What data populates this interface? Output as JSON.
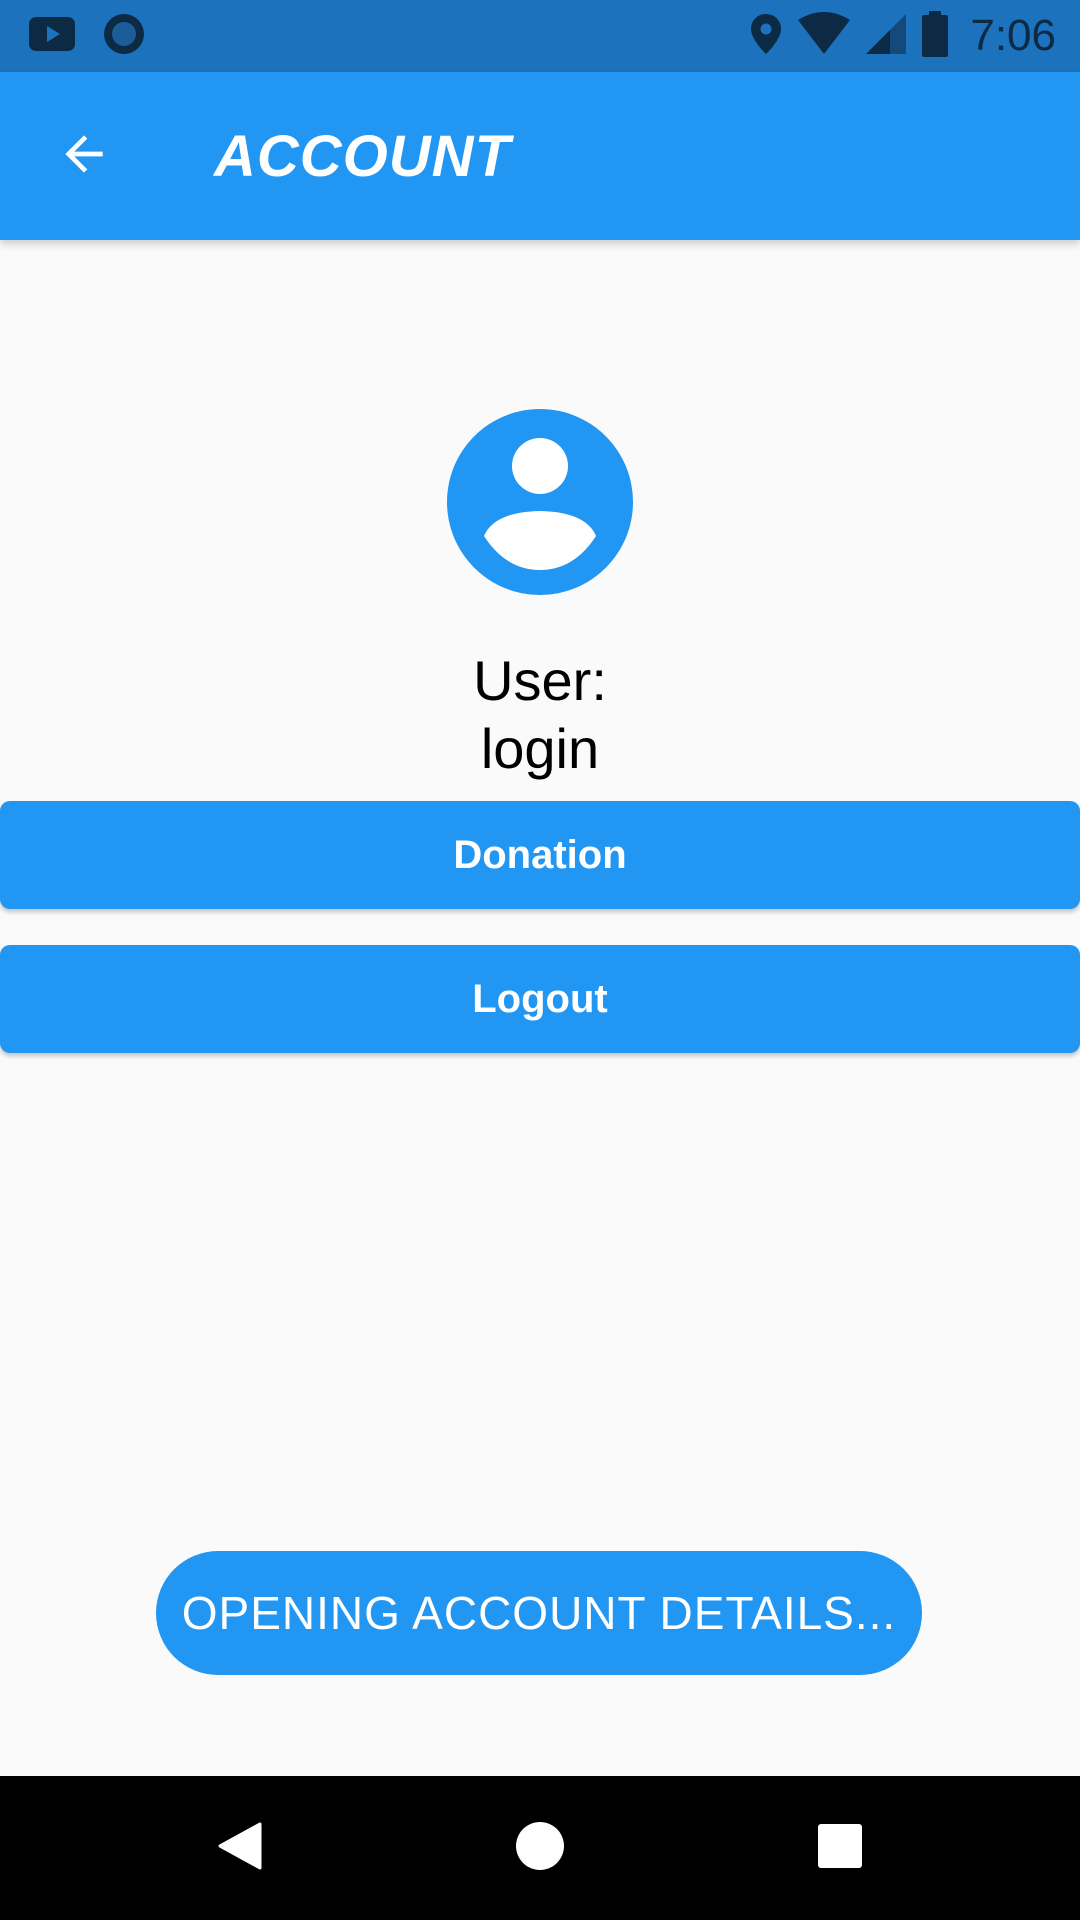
{
  "status_bar": {
    "time": "7:06",
    "icons": [
      "youtube-icon",
      "circle-app-icon",
      "location-icon",
      "wifi-icon",
      "cellular-signal-icon",
      "battery-icon"
    ]
  },
  "app_bar": {
    "title": "ACCOUNT",
    "back_icon": "arrow-back-icon"
  },
  "profile": {
    "avatar_icon": "account-circle-icon",
    "user_label": "User:",
    "user_name": "login"
  },
  "buttons": {
    "donation_label": "Donation",
    "logout_label": "Logout"
  },
  "toast": {
    "message": "OPENING ACCOUNT DETAILS..."
  },
  "nav_bar": {
    "icons": [
      "nav-back-icon",
      "nav-home-icon",
      "nav-recents-icon"
    ]
  },
  "colors": {
    "primary": "#2196F3",
    "status_bar": "#1C72BD",
    "background": "#FAFAFA"
  }
}
